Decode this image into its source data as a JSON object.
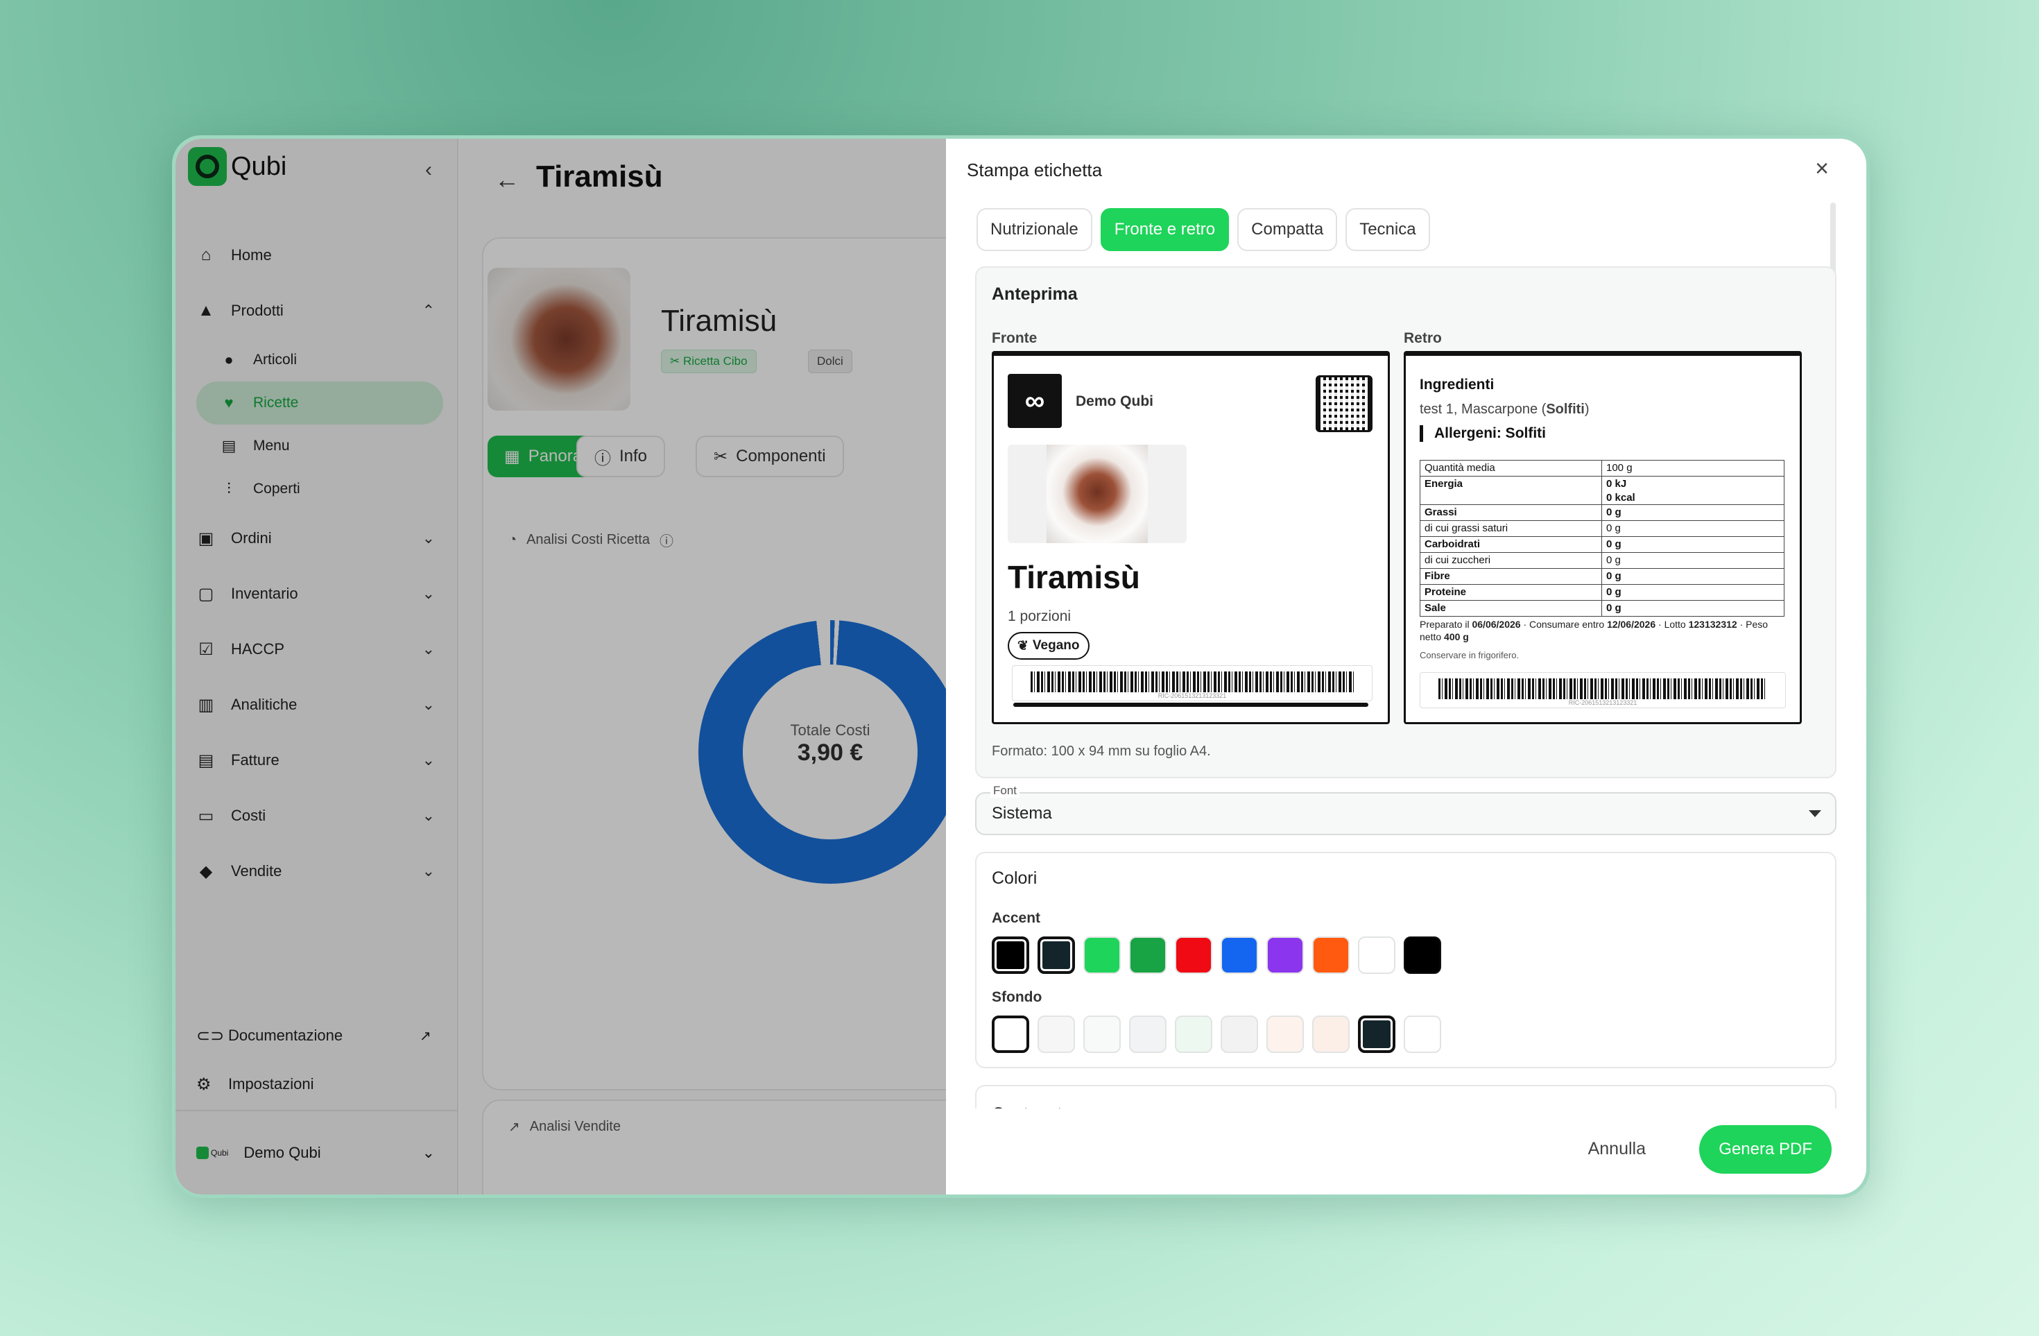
{
  "app": {
    "name": "Qubi"
  },
  "sidebar": {
    "items": [
      {
        "label": "Home",
        "icon": "home-icon"
      },
      {
        "label": "Prodotti",
        "icon": "shapes-icon"
      },
      {
        "label": "Ordini",
        "icon": "cart-icon"
      },
      {
        "label": "Inventario",
        "icon": "clipboard-icon"
      },
      {
        "label": "HACCP",
        "icon": "checklist-icon"
      },
      {
        "label": "Analitiche",
        "icon": "bar-chart-icon"
      },
      {
        "label": "Fatture",
        "icon": "invoice-icon"
      },
      {
        "label": "Costi",
        "icon": "card-icon"
      },
      {
        "label": "Vendite",
        "icon": "tag-icon"
      }
    ],
    "prodotti_sub": [
      {
        "label": "Articoli"
      },
      {
        "label": "Ricette"
      },
      {
        "label": "Menu"
      },
      {
        "label": "Coperti"
      }
    ],
    "documentazione": "Documentazione",
    "impostazioni": "Impostazioni",
    "user": "Demo Qubi",
    "user_logo": "Qubi"
  },
  "page": {
    "title": "Tiramisù",
    "recipe_name": "Tiramisù",
    "tags": [
      "Ricetta Cibo",
      "Dolci"
    ],
    "tabs": [
      "Panoramica",
      "Info",
      "Componenti"
    ],
    "cost_section": "Analisi Costi Ricetta",
    "donut_label": "Totale Costi",
    "donut_value": "3,90 €",
    "sales_section": "Analisi Vendite"
  },
  "modal": {
    "title": "Stampa etichetta",
    "tabs": [
      "Nutrizionale",
      "Fronte e retro",
      "Compatta",
      "Tecnica"
    ],
    "active_tab": "Fronte e retro",
    "preview_title": "Anteprima",
    "front_label": "Fronte",
    "back_label": "Retro",
    "front": {
      "brand": "Demo Qubi",
      "name": "Tiramisù",
      "portions": "1 porzioni",
      "badge": "Vegano",
      "barcode_text": "RIC-2061513213123321"
    },
    "back": {
      "ingredients_title": "Ingredienti",
      "ingredients_pre": "test 1, Mascarpone (",
      "ingredients_bold": "Solfiti",
      "ingredients_post": ")",
      "allergens": "Allergeni: Solfiti",
      "nutrition": [
        [
          "Quantità media",
          "100 g"
        ],
        [
          "Energia",
          "0 kJ"
        ],
        [
          "",
          "0 kcal"
        ],
        [
          "Grassi",
          "0 g"
        ],
        [
          "di cui grassi saturi",
          "0 g"
        ],
        [
          "Carboidrati",
          "0 g"
        ],
        [
          "di cui zuccheri",
          "0 g"
        ],
        [
          "Fibre",
          "0 g"
        ],
        [
          "Proteine",
          "0 g"
        ],
        [
          "Sale",
          "0 g"
        ]
      ],
      "prep_1": "Preparato il ",
      "prep_date": "06/06/2026",
      "prep_2": " · Consumare entro ",
      "expiry_date": "12/06/2026",
      "prep_3": " · Lotto ",
      "lot": "123132312",
      "prep_4": " · Peso netto ",
      "weight": "400 g",
      "storage": "Conservare in frigorifero.",
      "barcode_text": "RIC-2061513213123321"
    },
    "format": "Formato: 100 x 94 mm su foglio A4.",
    "font_label": "Font",
    "font_value": "Sistema",
    "colors_title": "Colori",
    "accent_label": "Accent",
    "accent_colors": [
      "#000000",
      "#14242b",
      "#1ed45a",
      "#18a345",
      "#ef0a14",
      "#1466f0",
      "#8b35ee",
      "#ff5a0f",
      "#ffffff",
      "#000000"
    ],
    "background_label": "Sfondo",
    "background_colors": [
      "#ffffff",
      "#f6f6f7",
      "#f7faf8",
      "#f2f3f4",
      "#ecf8f0",
      "#f2f2f3",
      "#fdf3ec",
      "#fcefe8",
      "#14242b",
      "#ffffff"
    ],
    "contenuto": "Contenuto",
    "cancel": "Annulla",
    "generate": "Genera PDF"
  }
}
